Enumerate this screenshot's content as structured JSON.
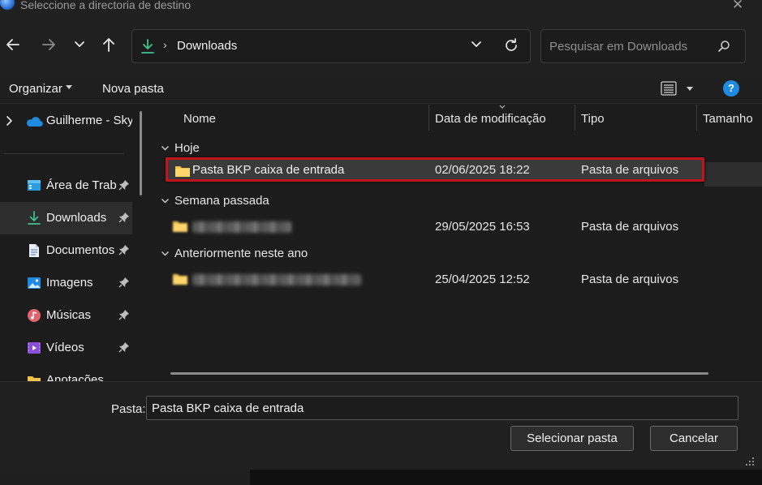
{
  "window": {
    "title": "Seleccione a directoria de destino",
    "close_glyph": "✕"
  },
  "navigation": {
    "back_icon": "arrow-left-icon",
    "forward_icon": "arrow-right-icon",
    "recent_icon": "chevron-down-icon",
    "up_icon": "arrow-up-icon"
  },
  "address_bar": {
    "location_icon": "download-icon",
    "separator": "›",
    "current": "Downloads"
  },
  "search": {
    "placeholder": "Pesquisar em Downloads"
  },
  "toolbar": {
    "organize_label": "Organizar",
    "new_folder_label": "Nova pasta"
  },
  "sidebar": {
    "top_item": {
      "label": "Guilherme - Skyl",
      "icon": "onedrive-cloud-icon"
    },
    "items": [
      {
        "label": "Área de Trab",
        "icon": "desktop-icon",
        "pinned": true
      },
      {
        "label": "Downloads",
        "icon": "download-icon",
        "pinned": true,
        "active": true
      },
      {
        "label": "Documentos",
        "icon": "document-icon",
        "pinned": true
      },
      {
        "label": "Imagens",
        "icon": "pictures-icon",
        "pinned": true
      },
      {
        "label": "Músicas",
        "icon": "music-icon",
        "pinned": true
      },
      {
        "label": "Vídeos",
        "icon": "videos-icon",
        "pinned": true
      },
      {
        "label": "Anotações",
        "icon": "folder-icon",
        "pinned": false
      }
    ]
  },
  "columns": {
    "name": "Nome",
    "modified": "Data de modificação",
    "type": "Tipo",
    "size": "Tamanho"
  },
  "groups": [
    {
      "label": "Hoje",
      "files": [
        {
          "name": "Pasta BKP caixa de entrada",
          "modified": "02/06/2025 18:22",
          "type": "Pasta de arquivos",
          "selected": true
        }
      ]
    },
    {
      "label": "Semana passada",
      "files": [
        {
          "name": "",
          "blurred": true,
          "modified": "29/05/2025 16:53",
          "type": "Pasta de arquivos"
        }
      ]
    },
    {
      "label": "Anteriormente neste ano",
      "files": [
        {
          "name": "",
          "blurred": true,
          "modified": "25/04/2025 12:52",
          "type": "Pasta de arquivos"
        }
      ]
    }
  ],
  "footer": {
    "folder_label": "Pasta:",
    "folder_value": "Pasta BKP caixa de entrada",
    "select_button": "Selecionar pasta",
    "cancel_button": "Cancelar"
  },
  "colors": {
    "accent": "#1e8ae0",
    "folder": "#f0c34a",
    "selection_outline": "#c0141c",
    "download_green": "#3ec28f"
  }
}
